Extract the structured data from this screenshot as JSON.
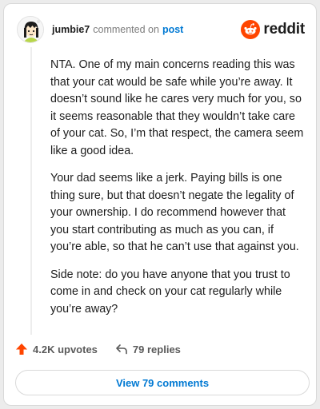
{
  "header": {
    "username": "jumbie7",
    "action_text": "commented on",
    "post_link_text": "post",
    "logo_text": "reddit",
    "avatar_icon": "snoo-avatar-icon",
    "logo_icon": "reddit-alien-icon"
  },
  "comment": {
    "paragraphs": [
      "NTA. One of my main concerns reading this was that your cat would be safe while you’re away. It doesn’t sound like he cares very much for you, so it seems reasonable that they wouldn’t take care of your cat. So, I’m that respect, the camera seem like a good idea.",
      "Your dad seems like a jerk. Paying bills is one thing sure, but that doesn’t negate the legality of your ownership. I do recommend however that you start contributing as much as you can, if you’re able, so that he can’t use that against you.",
      "Side note: do you have anyone that you trust to come in and check on your cat regularly while you’re away?"
    ]
  },
  "actions": {
    "upvotes_label": "4.2K upvotes",
    "replies_label": "79 replies",
    "upvote_icon": "upvote-arrow-icon",
    "reply_icon": "reply-arrow-icon"
  },
  "footer": {
    "view_comments_label": "View 79 comments"
  },
  "colors": {
    "reddit_orange": "#ff4500",
    "link_blue": "#0079d3",
    "upvote_red": "#ff4500"
  }
}
